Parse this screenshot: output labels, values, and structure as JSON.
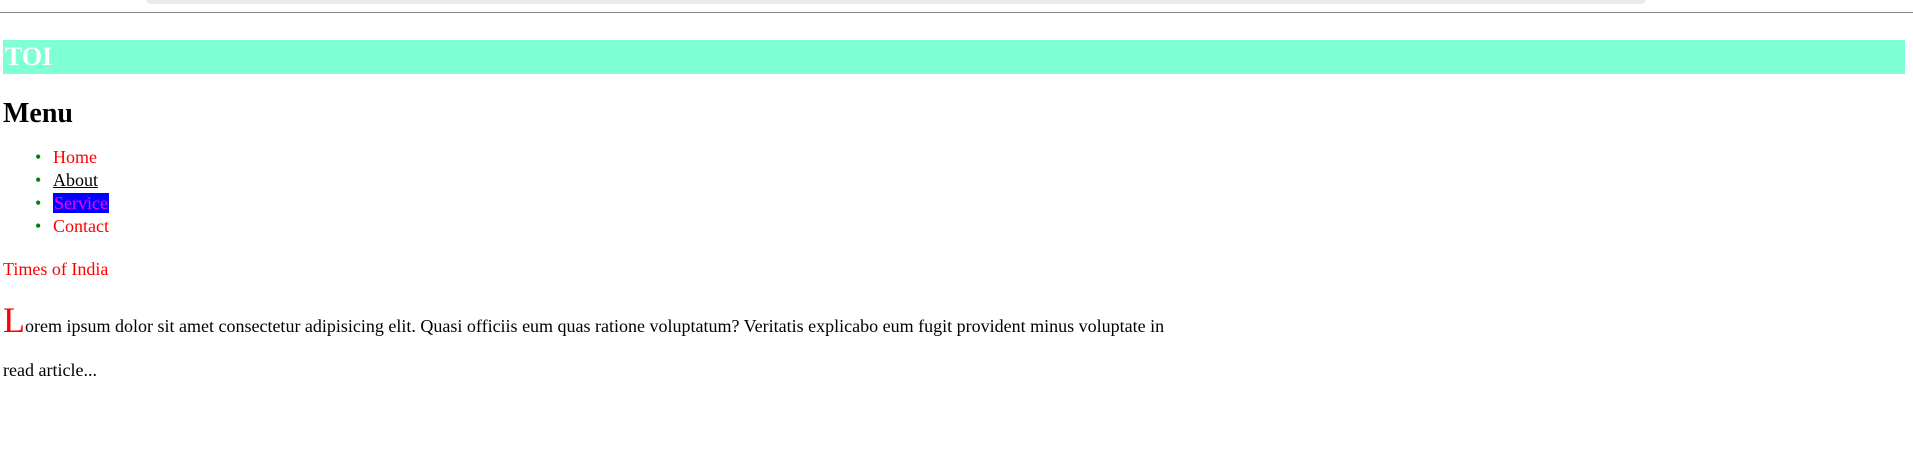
{
  "banner": {
    "title": "TOI",
    "background": "#7fffd4",
    "text_color": "#ffffff"
  },
  "menu": {
    "heading": "Menu",
    "bullet_color": "#008000",
    "items": [
      {
        "label": "Home",
        "color": "#ff0000"
      },
      {
        "label": "About",
        "color": "#000000"
      },
      {
        "label": "Service",
        "color": "#ff00ff",
        "highlight": "#0000ff"
      },
      {
        "label": "Contact",
        "color": "#ff0000"
      }
    ]
  },
  "tagline": "Times of India",
  "article": {
    "drop_cap": "L",
    "body": "orem ipsum dolor sit amet consectetur adipisicing elit. Quasi officiis eum quas ratione voluptatum? Veritatis explicabo eum fugit provident minus voluptate in",
    "read_more": "read article..."
  }
}
